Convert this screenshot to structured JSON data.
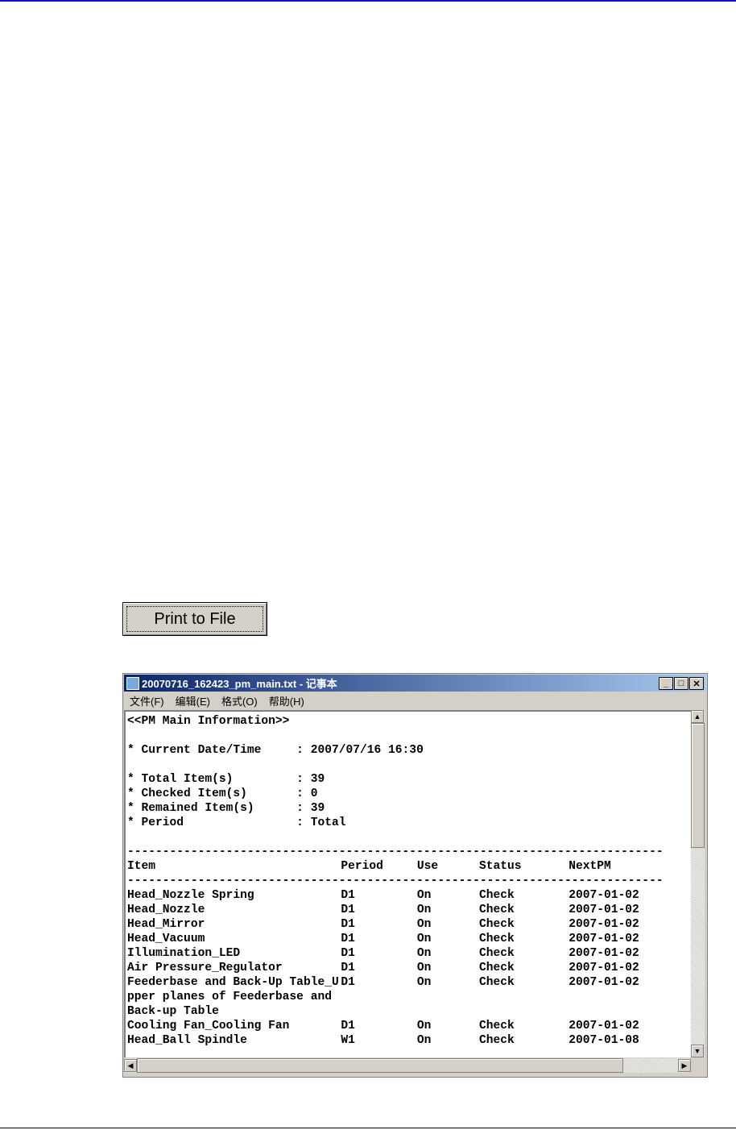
{
  "button": {
    "label": "Print to File"
  },
  "notepad": {
    "title": "20070716_162423_pm_main.txt - 记事本",
    "menu": [
      "文件(F)",
      "编辑(E)",
      "格式(O)",
      "帮助(H)"
    ],
    "header_lines": [
      "<<PM Main Information>>",
      "",
      "* Current Date/Time     : 2007/07/16 16:30",
      "",
      "* Total Item(s)         : 39",
      "* Checked Item(s)       : 0",
      "* Remained Item(s)      : 39",
      "* Period                : Total",
      ""
    ],
    "divider": "----------------------------------------------------------------------------",
    "columns": [
      "Item",
      "Period",
      "Use",
      "Status",
      "NextPM"
    ],
    "rows": [
      [
        "Head_Nozzle Spring",
        "D1",
        "On",
        "Check",
        "2007-01-02"
      ],
      [
        "Head_Nozzle",
        "D1",
        "On",
        "Check",
        "2007-01-02"
      ],
      [
        "Head_Mirror",
        "D1",
        "On",
        "Check",
        "2007-01-02"
      ],
      [
        "Head_Vacuum",
        "D1",
        "On",
        "Check",
        "2007-01-02"
      ],
      [
        "Illumination_LED",
        "D1",
        "On",
        "Check",
        "2007-01-02"
      ],
      [
        "Air Pressure_Regulator",
        "D1",
        "On",
        "Check",
        "2007-01-02"
      ],
      [
        "Feederbase and Back-Up Table_U",
        "D1",
        "On",
        "Check",
        "2007-01-02"
      ],
      [
        "pper planes of Feederbase and",
        "",
        "",
        "",
        ""
      ],
      [
        "Back-up Table",
        "",
        "",
        "",
        ""
      ],
      [
        "Cooling Fan_Cooling Fan",
        "D1",
        "On",
        "Check",
        "2007-01-02"
      ],
      [
        "Head_Ball Spindle",
        "W1",
        "On",
        "Check",
        "2007-01-08"
      ]
    ]
  }
}
